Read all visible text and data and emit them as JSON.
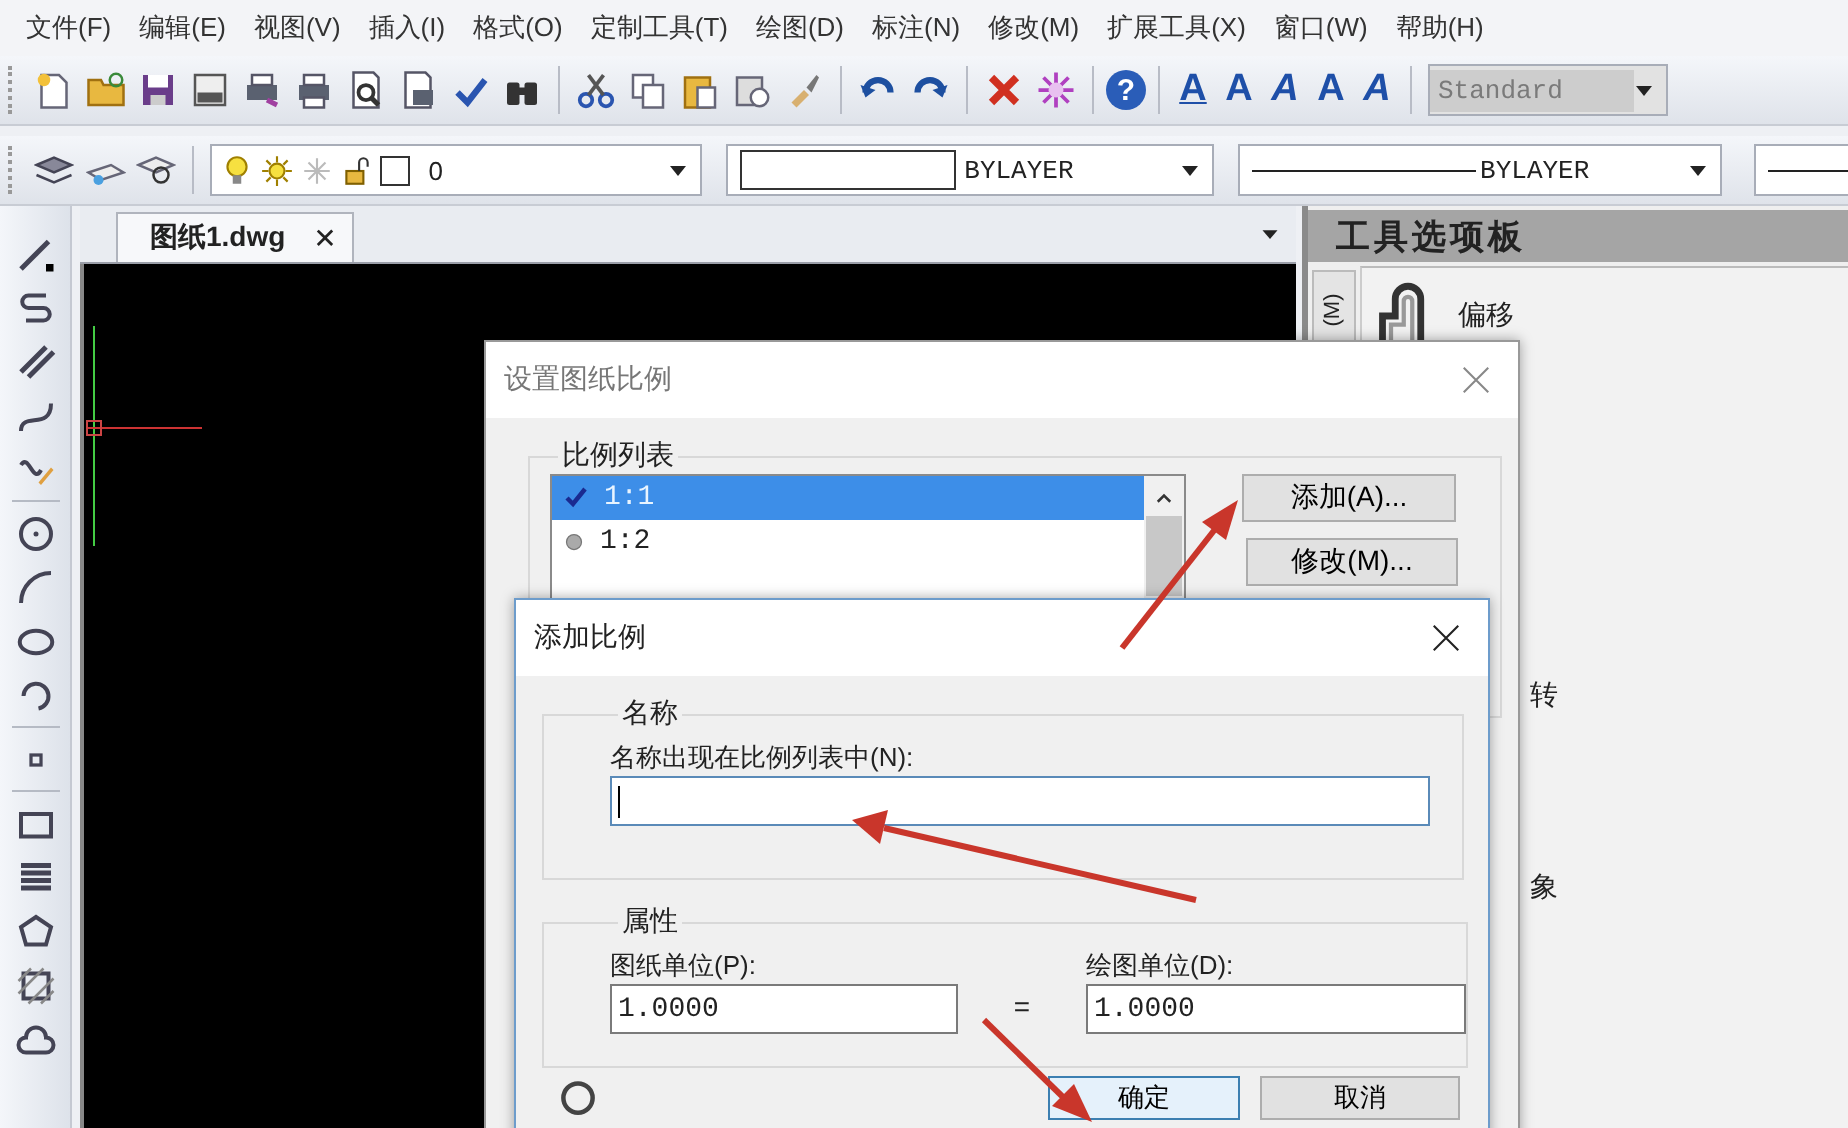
{
  "menu": [
    {
      "label": "文件(F)"
    },
    {
      "label": "编辑(E)"
    },
    {
      "label": "视图(V)"
    },
    {
      "label": "插入(I)"
    },
    {
      "label": "格式(O)"
    },
    {
      "label": "定制工具(T)"
    },
    {
      "label": "绘图(D)"
    },
    {
      "label": "标注(N)"
    },
    {
      "label": "修改(M)"
    },
    {
      "label": "扩展工具(X)"
    },
    {
      "label": "窗口(W)"
    },
    {
      "label": "帮助(H)"
    }
  ],
  "standard_toolbar": {
    "help_glyph": "?",
    "text_style_glyphs": [
      "A",
      "A",
      "A",
      "A",
      "A"
    ],
    "text_style_combo": {
      "value": "Standard",
      "disabled": true
    }
  },
  "properties_toolbar": {
    "layer": "0",
    "color_label": "BYLAYER",
    "linetype": "BYLAYER"
  },
  "document_tabs": [
    {
      "label": "图纸1.dwg",
      "selected": true,
      "close": "✕"
    }
  ],
  "tool_palette": {
    "title": "工具选项板",
    "side_tab": "(M)",
    "items": [
      {
        "label": "偏移",
        "kind": "icon_item"
      },
      {
        "label": "转",
        "kind": "label_only"
      },
      {
        "label": "象",
        "kind": "label_only"
      }
    ]
  },
  "scale_dialog": {
    "title": "设置图纸比例",
    "group": "比例列表",
    "scale_list": [
      {
        "label": "1:1",
        "selected": true
      },
      {
        "label": "1:2",
        "selected": false
      }
    ],
    "buttons": [
      "添加(A)...",
      "修改(M)..."
    ]
  },
  "add_scale_dialog": {
    "title": "添加比例",
    "name_group": "名称",
    "name_label": "名称出现在比例列表中(N):",
    "properties_group": "属性",
    "paper_units_label": "图纸单位(P):",
    "paper_units": "1.0000",
    "equals": "=",
    "drawing_units_label": "绘图单位(D):",
    "drawing_units": "1.0000",
    "buttons": [
      "确定",
      "取消"
    ]
  }
}
